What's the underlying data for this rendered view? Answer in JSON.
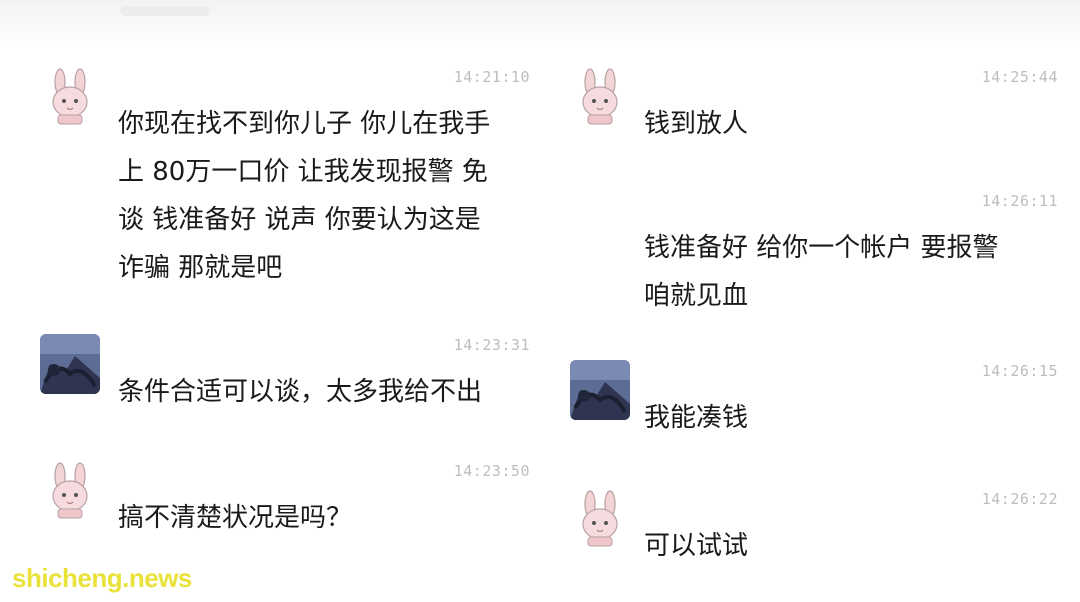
{
  "watermark": "shicheng.news",
  "left_messages": [
    {
      "avatar": "rabbit-avatar",
      "time": "14:21:10",
      "lines": [
        "你现在找不到你儿子 你儿在我手",
        "上 80万一口价 让我发现报警 免",
        "谈 钱准备好 说声 你要认为这是",
        "诈骗 那就是吧"
      ]
    },
    {
      "avatar": "dark-photo-avatar",
      "time": "14:23:31",
      "lines": [
        "条件合适可以谈，太多我给不出"
      ]
    },
    {
      "avatar": "rabbit-avatar",
      "time": "14:23:50",
      "lines": [
        "搞不清楚状况是吗？"
      ]
    }
  ],
  "right_messages": [
    {
      "avatar": "rabbit-avatar",
      "time": "14:25:44",
      "lines": [
        "钱到放人"
      ]
    },
    {
      "avatar": "",
      "time": "14:26:11",
      "lines": [
        "钱准备好 给你一个帐户 要报警",
        "咱就见血"
      ]
    },
    {
      "avatar": "dark-photo-avatar",
      "time": "14:26:15",
      "lines": [
        "我能凑钱"
      ]
    },
    {
      "avatar": "rabbit-avatar",
      "time": "14:26:22",
      "lines": [
        "可以试试"
      ]
    }
  ]
}
